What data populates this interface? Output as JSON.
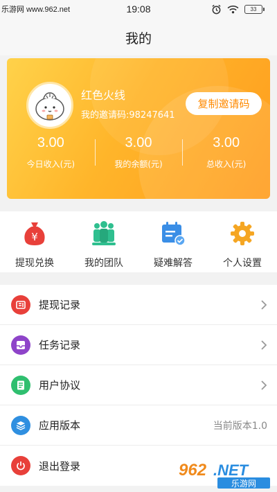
{
  "status_bar": {
    "watermark": "乐游网 www.962.net",
    "time": "19:08",
    "battery": "33"
  },
  "header": {
    "title": "我的"
  },
  "profile": {
    "name": "红色火线",
    "invite_code": "我的邀请码:98247641",
    "copy_button": "复制邀请码",
    "stats": [
      {
        "value": "3.00",
        "label": "今日收入(元)"
      },
      {
        "value": "3.00",
        "label": "我的余额(元)"
      },
      {
        "value": "3.00",
        "label": "总收入(元)"
      }
    ]
  },
  "quick_actions": [
    {
      "label": "提现兑换",
      "icon": "money-bag-icon",
      "color": "#e8403a"
    },
    {
      "label": "我的团队",
      "icon": "team-icon",
      "color": "#2fbf8f"
    },
    {
      "label": "疑难解答",
      "icon": "calendar-check-icon",
      "color": "#3a8ee6"
    },
    {
      "label": "个人设置",
      "icon": "gear-icon",
      "color": "#f5a623"
    }
  ],
  "menu": [
    {
      "label": "提现记录",
      "icon": "withdraw-record-icon",
      "color": "#e8403a",
      "right": ""
    },
    {
      "label": "任务记录",
      "icon": "task-record-icon",
      "color": "#8e44c9",
      "right": ""
    },
    {
      "label": "用户协议",
      "icon": "document-icon",
      "color": "#2fbf6f",
      "right": ""
    },
    {
      "label": "应用版本",
      "icon": "layers-icon",
      "color": "#2f8fe0",
      "right": "当前版本1.0"
    },
    {
      "label": "退出登录",
      "icon": "power-icon",
      "color": "#e8403a",
      "right": ""
    }
  ],
  "watermark": {
    "brand": "962",
    "domain": ".NET",
    "caption": "乐游网"
  }
}
